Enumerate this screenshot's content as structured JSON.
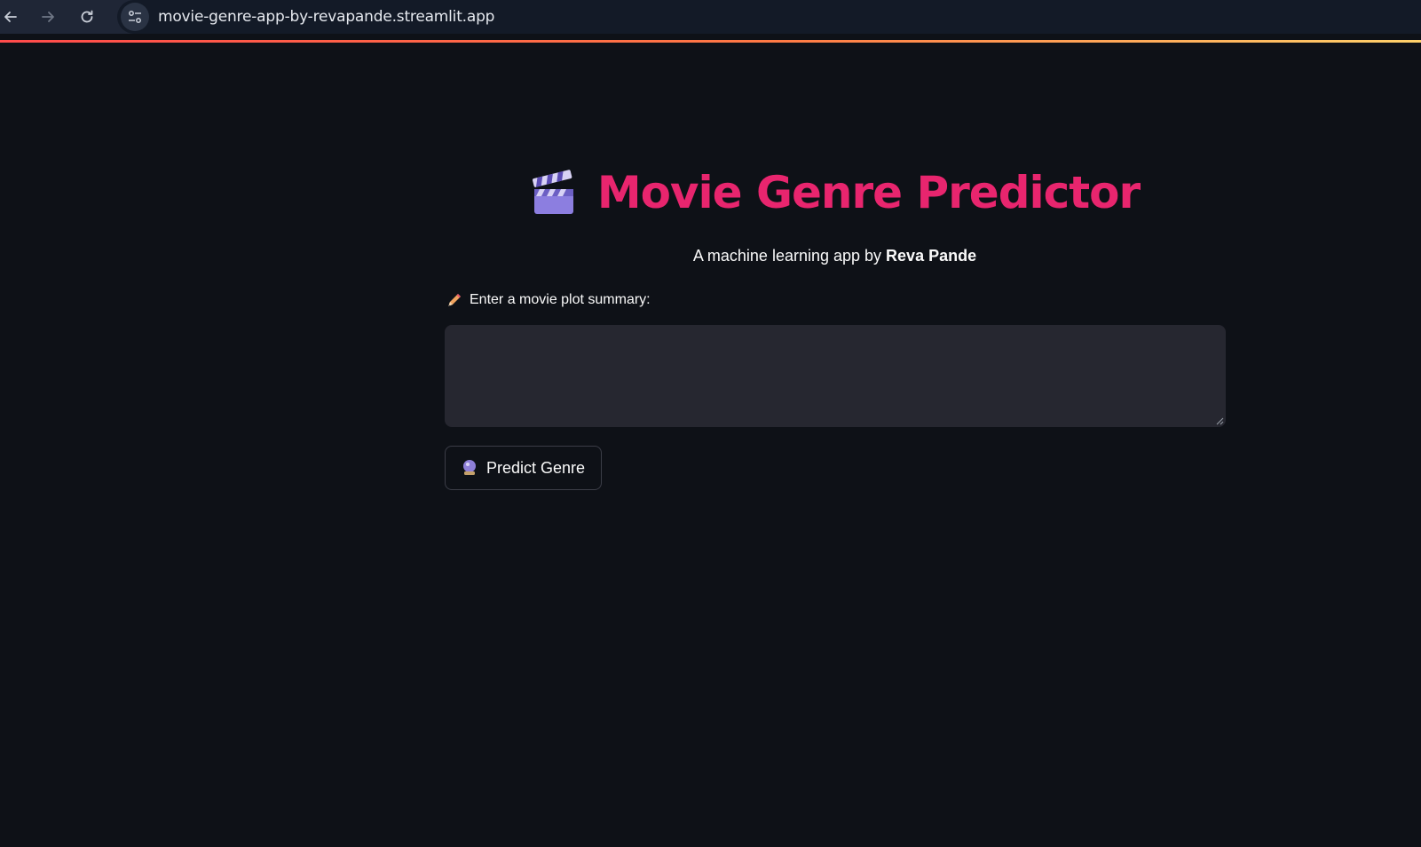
{
  "browser": {
    "url": "movie-genre-app-by-revapande.streamlit.app"
  },
  "app": {
    "title": "Movie Genre Predictor",
    "subtitle_prefix": "A machine learning app by ",
    "subtitle_author": "Reva Pande",
    "input_label": "Enter a movie plot summary:",
    "input_value": "",
    "button_label": "Predict Genre",
    "title_icon": "clapper-board-icon",
    "label_icon": "pencil-icon",
    "button_icon": "crystal-ball-icon"
  },
  "colors": {
    "background": "#0e1117",
    "title": "#e8256e",
    "textarea": "#262730",
    "text": "#fafafa"
  }
}
